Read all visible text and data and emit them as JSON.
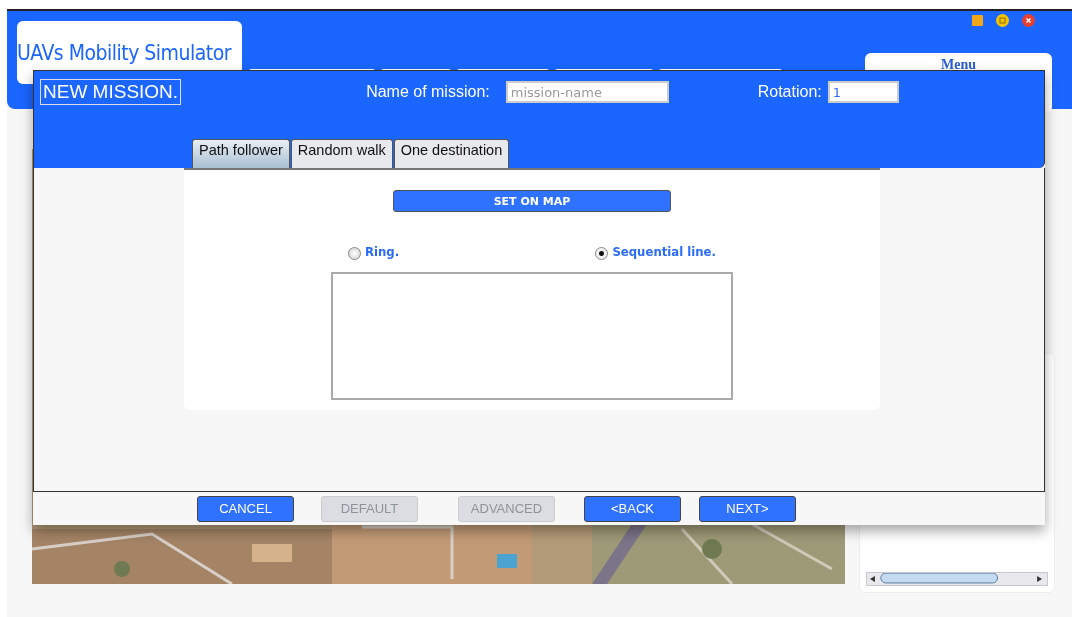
{
  "app": {
    "title": "UAVs Mobility Simulator",
    "menu_title": "Menu"
  },
  "dialog": {
    "title": "NEW MISSION.",
    "name_label": "Name of mission:",
    "name_field": {
      "placeholder": "mission-name"
    },
    "rotation_label": "Rotation:",
    "rotation_field": {
      "value": "1"
    },
    "tabs": [
      {
        "label": "Path follower",
        "selected": true
      },
      {
        "label": "Random walk",
        "selected": false
      },
      {
        "label": "One destination",
        "selected": false
      }
    ],
    "set_on_map": "SET ON MAP",
    "path_types": [
      {
        "label": "Ring.",
        "selected": false
      },
      {
        "label": "Sequential line.",
        "selected": true
      }
    ],
    "buttons": [
      {
        "label": "CANCEL",
        "disabled": false
      },
      {
        "label": "DEFAULT",
        "disabled": true
      },
      {
        "label": "ADVANCED",
        "disabled": true
      },
      {
        "label": "<BACK",
        "disabled": false
      },
      {
        "label": "NEXT>",
        "disabled": false
      }
    ]
  }
}
